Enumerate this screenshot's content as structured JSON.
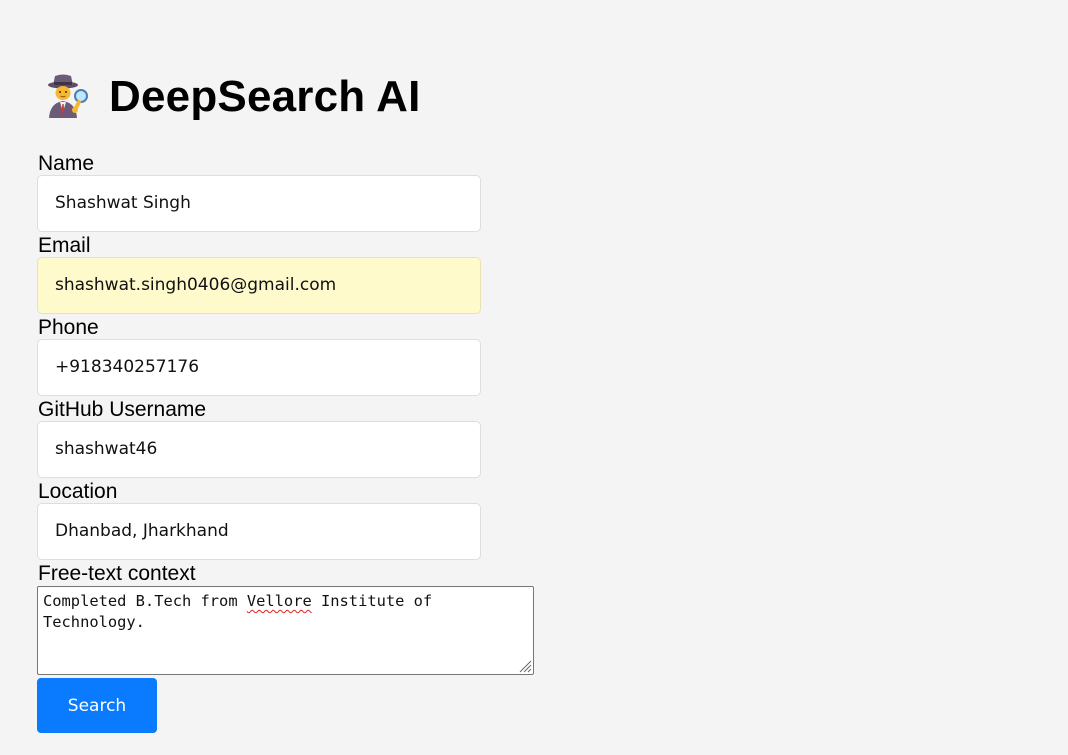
{
  "app": {
    "title": "DeepSearch AI",
    "icon": "detective-icon"
  },
  "form": {
    "name": {
      "label": "Name",
      "value": "Shashwat Singh"
    },
    "email": {
      "label": "Email",
      "value": "shashwat.singh0406@gmail.com",
      "autofilled": true
    },
    "phone": {
      "label": "Phone",
      "value": "+918340257176"
    },
    "github": {
      "label": "GitHub Username",
      "value": "shashwat46"
    },
    "location": {
      "label": "Location",
      "value": "Dhanbad, Jharkhand"
    },
    "context": {
      "label": "Free-text context",
      "value_before": "Completed B.Tech from ",
      "value_misspelled": "Vellore",
      "value_after": " Institute of Technology."
    },
    "search_button": "Search"
  },
  "colors": {
    "background": "#f4f4f4",
    "autofill": "#fefacb",
    "button": "#0a7bff",
    "spellcheck": "#e02020"
  }
}
